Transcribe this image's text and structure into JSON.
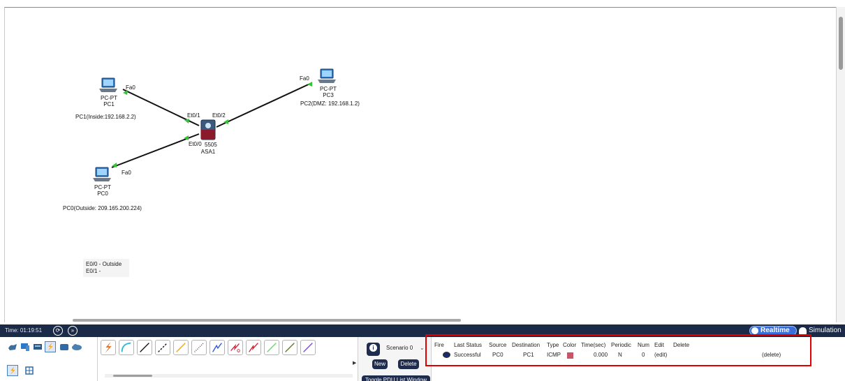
{
  "topology": {
    "devices": [
      {
        "id": "pc1",
        "type": "PC-PT",
        "name": "PC1",
        "desc": "PC1(Inside:192.168.2.2)",
        "port": "Fa0"
      },
      {
        "id": "pc3",
        "type": "PC-PT",
        "name": "PC3",
        "desc": "PC2(DMZ: 192.168.1.2)",
        "port": "Fa0"
      },
      {
        "id": "pc0",
        "type": "PC-PT",
        "name": "PC0",
        "desc": "PC0(Outside: 209.165.200.224)",
        "port": "Fa0"
      },
      {
        "id": "asa1",
        "type": "5505",
        "name": "ASA1",
        "ports": [
          "Et0/1",
          "Et0/2",
          "Et0/0"
        ]
      }
    ],
    "note_lines": [
      "E0/0 - Outside",
      "E0/1 -"
    ],
    "link_color": "#111111",
    "link_light_color": "#35c435"
  },
  "timebar": {
    "time": "Time: 01:19:51",
    "realtime": "Realtime",
    "simulation": "Simulation",
    "bar_color": "#1b2a47"
  },
  "scenario": {
    "selected": "Scenario 0",
    "new": "New",
    "delete": "Delete",
    "toggle": "Toggle PDU List Window"
  },
  "pdu_table": {
    "headers": [
      "Fire",
      "Last Status",
      "Source",
      "Destination",
      "Type",
      "Color",
      "Time(sec)",
      "Periodic",
      "Num",
      "Edit",
      "Delete"
    ],
    "rows": [
      {
        "last_status": "Successful",
        "source": "PC0",
        "destination": "PC1",
        "type": "ICMP",
        "color": "#c9546a",
        "time": "0.000",
        "periodic": "N",
        "num": "0",
        "edit": "(edit)",
        "delete": "(delete)"
      }
    ]
  },
  "icons": {
    "device_categories": [
      "network-devices-icon",
      "end-devices-icon",
      "components-icon",
      "connections-icon",
      "misc-icon",
      "multiuser-icon"
    ],
    "connection_types": [
      "automatic-connection-icon",
      "console-cable-icon",
      "straight-through-icon",
      "crossover-icon",
      "fiber-icon",
      "phone-cable-icon",
      "coaxial-icon",
      "serial-dce-icon",
      "serial-dte-icon",
      "octal-icon",
      "iot-custom-icon",
      "usb-icon"
    ]
  }
}
